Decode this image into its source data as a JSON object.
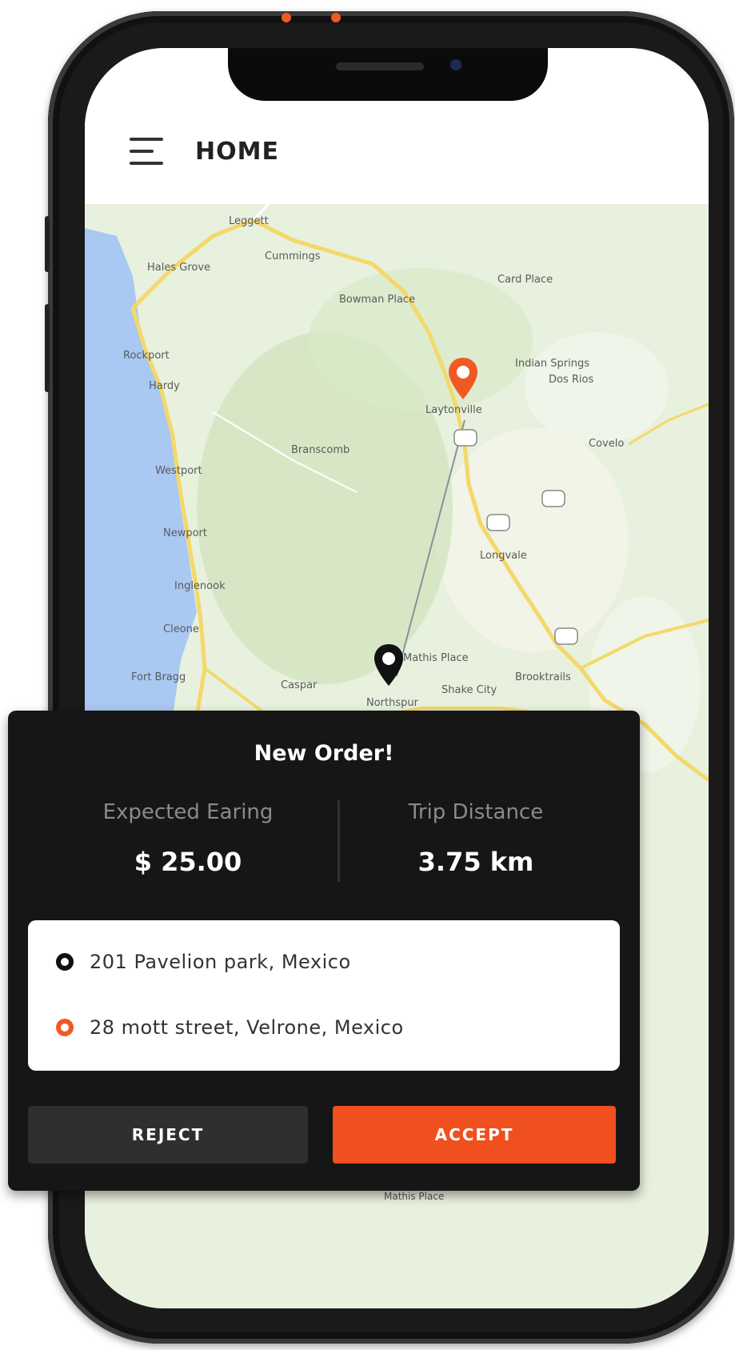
{
  "app": {
    "title": "HOME"
  },
  "map": {
    "labels": [
      "Leggett",
      "Hales Grove",
      "Cummings",
      "Bowman Place",
      "Card Place",
      "Rockport",
      "Hardy",
      "Indian Springs",
      "Dos Rios",
      "Laytonville",
      "Branscomb",
      "Westport",
      "Newport",
      "Inglenook",
      "Cleone",
      "Fort Bragg",
      "Caspar",
      "Mathis Place",
      "Shake City",
      "Northspur",
      "Longvale",
      "Brooktrails",
      "Covelo",
      "Mathis Place"
    ],
    "route_origin_pin": "black-location-pin-icon",
    "route_destination_pin": "orange-location-pin-icon",
    "accent_color": "#f05a22"
  },
  "order": {
    "title": "New Order!",
    "expected_earning_label": "Expected Earing",
    "expected_earning_value": "$ 25.00",
    "trip_distance_label": "Trip Distance",
    "trip_distance_value": "3.75 km",
    "pickup_address": "201 Pavelion park, Mexico",
    "dropoff_address": "28 mott street, Velrone, Mexico",
    "reject_label": "REJECT",
    "accept_label": "ACCEPT"
  }
}
